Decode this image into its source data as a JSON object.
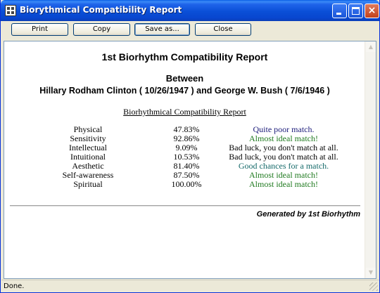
{
  "window": {
    "title": "Biorythmical Compatibility Report",
    "icon": "report-icon",
    "controls": {
      "minimize": "minimize-icon",
      "maximize": "maximize-icon",
      "close": "×"
    }
  },
  "toolbar": {
    "print_label": "Print",
    "copy_label": "Copy",
    "save_label": "Save as...",
    "close_label": "Close"
  },
  "report": {
    "title": "1st Biorhythm Compatibility Report",
    "between": "Between",
    "names": "Hillary Rodham Clinton ( 10/26/1947 ) and George W. Bush ( 7/6/1946 )",
    "subtitle": "Biorhythmical Compatibility Report",
    "rows": [
      {
        "aspect": "Physical",
        "percent": "47.83%",
        "verdict": "Quite poor match.",
        "color": "#1c1c7a"
      },
      {
        "aspect": "Sensitivity",
        "percent": "92.86%",
        "verdict": "Almost ideal match!",
        "color": "#1f7a1f"
      },
      {
        "aspect": "Intellectual",
        "percent": "9.09%",
        "verdict": "Bad luck, you don't match at all.",
        "color": "#000000"
      },
      {
        "aspect": "Intuitional",
        "percent": "10.53%",
        "verdict": "Bad luck, you don't match at all.",
        "color": "#000000"
      },
      {
        "aspect": "Aesthetic",
        "percent": "81.40%",
        "verdict": "Good chances for a match.",
        "color": "#156a6a"
      },
      {
        "aspect": "Self-awareness",
        "percent": "87.50%",
        "verdict": "Almost ideal match!",
        "color": "#1f7a1f"
      },
      {
        "aspect": "Spiritual",
        "percent": "100.00%",
        "verdict": "Almost ideal match!",
        "color": "#1f7a1f"
      }
    ],
    "generated": "Generated by 1st Biorhythm"
  },
  "status": {
    "text": "Done."
  }
}
